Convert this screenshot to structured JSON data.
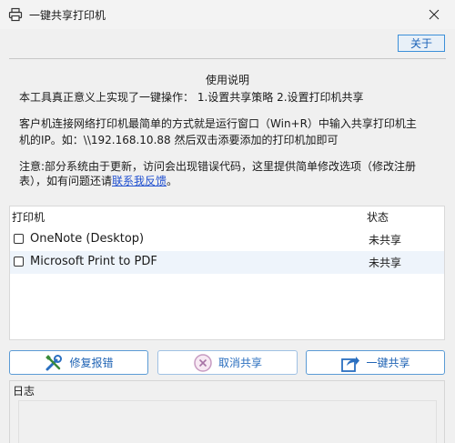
{
  "window": {
    "title": "一键共享打印机"
  },
  "toolbar": {
    "about_label": "关于"
  },
  "usage": {
    "title": "使用说明",
    "line1": "本工具真正意义上实现了一键操作：  1.设置共享策略 2.设置打印机共享",
    "line2": "客户机连接网络打印机最简单的方式就是运行窗口（Win+R）中输入共享打印机主",
    "line3": "机的IP。如：\\\\192.168.10.88 然后双击添要添加的打印机加即可",
    "line4": "注意:部分系统由于更新，访问会出现错误代码，这里提供简单修改选项（修改注册",
    "line5_prefix": "表），如有问题还请",
    "line5_link": "联系我反馈",
    "line5_suffix": "。"
  },
  "printers": {
    "col_printer": "打印机",
    "col_status": "状态",
    "rows": [
      {
        "name": "OneNote (Desktop)",
        "status": "未共享",
        "checked": false
      },
      {
        "name": "Microsoft Print to PDF",
        "status": "未共享",
        "checked": false
      }
    ]
  },
  "actions": {
    "repair_label": "修复报错",
    "cancel_share_label": "取消共享",
    "share_label": "一键共享"
  },
  "log": {
    "label": "日志"
  },
  "icons": {
    "app": "printer-icon",
    "close": "close-icon",
    "repair": "wrench-screwdriver-icon",
    "cancel": "cancel-circle-icon",
    "share": "share-arrow-icon"
  },
  "colors": {
    "accent": "#3c8fd8",
    "link": "#1f4fd0",
    "row_alt": "#eef4fb"
  }
}
